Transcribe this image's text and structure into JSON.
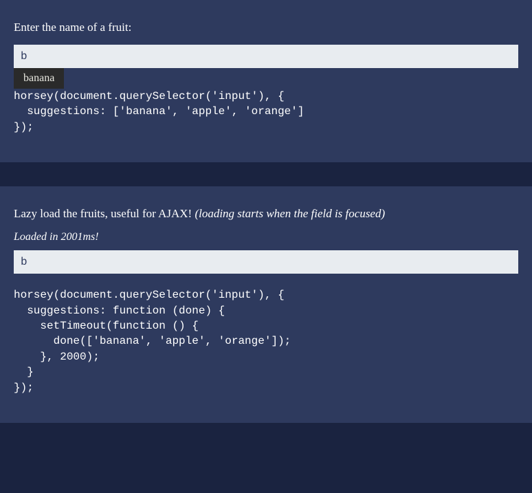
{
  "panel1": {
    "label": "Enter the name of a fruit:",
    "inputValue": "b",
    "suggestion": "banana",
    "code": "horsey(document.querySelector('input'), {\n  suggestions: ['banana', 'apple', 'orange']\n});"
  },
  "panel2": {
    "labelMain": "Lazy load the fruits, useful for AJAX! ",
    "labelItalic": "(loading starts when the field is focused)",
    "status": "Loaded in 2001ms!",
    "inputValue": "b",
    "code": "horsey(document.querySelector('input'), {\n  suggestions: function (done) {\n    setTimeout(function () {\n      done(['banana', 'apple', 'orange']);\n    }, 2000);\n  }\n});"
  }
}
